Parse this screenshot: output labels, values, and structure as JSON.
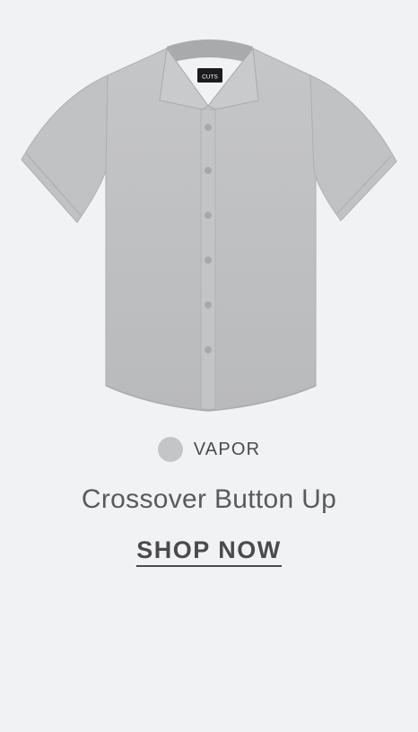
{
  "product": {
    "image_alt": "Crossover Button Up shirt",
    "brand_tag": "CUTS",
    "color": {
      "name": "VAPOR",
      "swatch_hex": "#c4c5c7"
    },
    "title": "Crossover Button Up",
    "cta_label": "SHOP NOW"
  },
  "colors": {
    "background": "#f1f2f4",
    "text": "#4a4a4a",
    "shirt": "#bfc0c2"
  }
}
